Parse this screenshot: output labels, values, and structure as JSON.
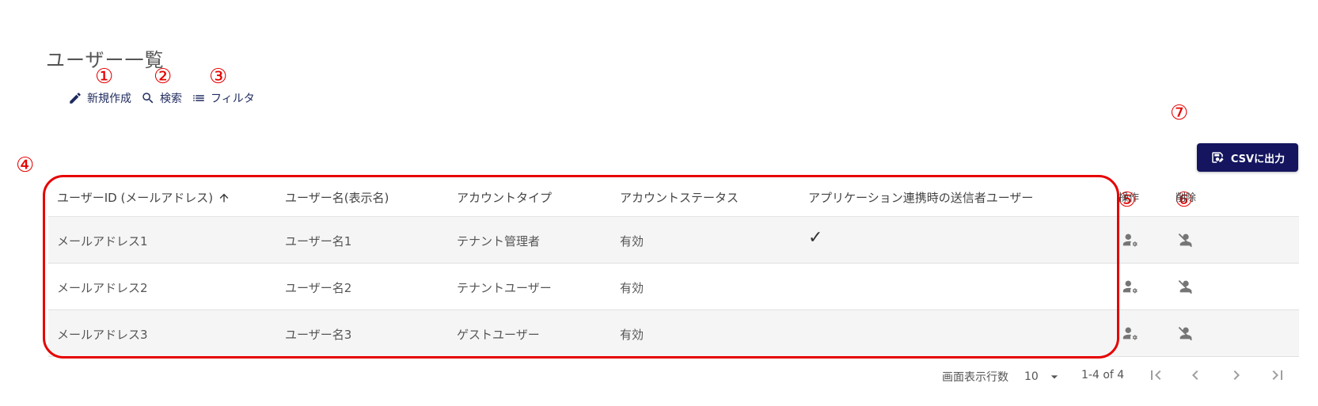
{
  "page": {
    "title": "ユーザー一覧"
  },
  "toolbar": {
    "new_label": "新規作成",
    "search_label": "検索",
    "filter_label": "フィルタ"
  },
  "annotations": [
    "①",
    "②",
    "③",
    "④",
    "⑤",
    "⑥",
    "⑦"
  ],
  "csv_button": {
    "label": "CSVに出力"
  },
  "table": {
    "headers": {
      "email": "ユーザーID (メールアドレス)",
      "username": "ユーザー名(表示名)",
      "account_type": "アカウントタイプ",
      "account_status": "アカウントステータス",
      "app_sender": "アプリケーション連携時の送信者ユーザー",
      "operation": "操作",
      "delete": "削除"
    },
    "rows": [
      {
        "email": "メールアドレス1",
        "username": "ユーザー名1",
        "account_type": "テナント管理者",
        "account_status": "有効",
        "app_sender": "✓"
      },
      {
        "email": "メールアドレス2",
        "username": "ユーザー名2",
        "account_type": "テナントユーザー",
        "account_status": "有効",
        "app_sender": ""
      },
      {
        "email": "メールアドレス3",
        "username": "ユーザー名3",
        "account_type": "ゲストユーザー",
        "account_status": "有効",
        "app_sender": ""
      }
    ]
  },
  "pagination": {
    "rows_per_page_label": "画面表示行数",
    "rows_per_page_value": "10",
    "range": "1-4 of 4"
  },
  "colors": {
    "primary": "#14155e",
    "annotation": "#e60000",
    "row_shade": "#f5f5f5"
  }
}
